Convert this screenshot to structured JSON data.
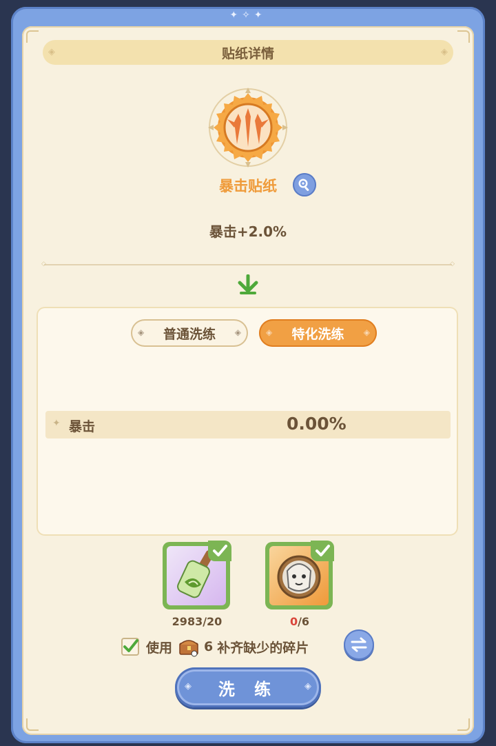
{
  "title": "贴纸详情",
  "sticker": {
    "name": "暴击贴纸",
    "stat": "暴击+2.0%"
  },
  "tabs": {
    "normal": "普通洗练",
    "special": "特化洗练",
    "active": "special"
  },
  "attribute": {
    "name": "暴击",
    "value": "0.00%"
  },
  "materials": {
    "item1_count": "2983/20",
    "item2_owned": "0",
    "item2_need": "/6"
  },
  "use_row": {
    "label": "使用",
    "qty": "6",
    "desc": "补齐缺少的碎片",
    "checked": true
  },
  "refine_button": "洗 练",
  "colors": {
    "frame_blue": "#7da3e3",
    "panel_cream": "#f8f1df",
    "accent_orange": "#f1a044",
    "text_brown": "#6b5338",
    "check_green": "#7cb554"
  }
}
